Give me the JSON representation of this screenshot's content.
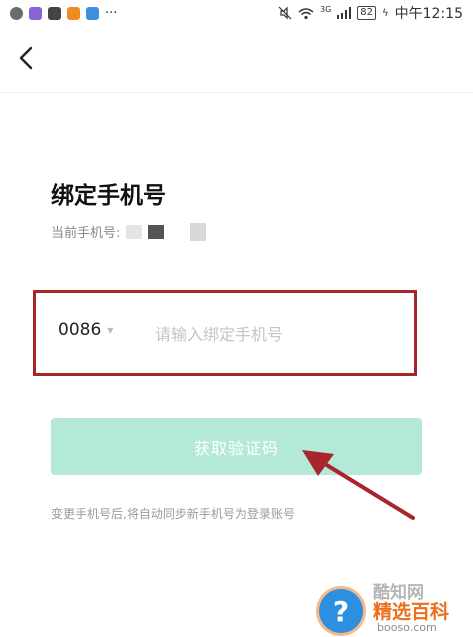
{
  "status_bar": {
    "battery": "82",
    "network": "3G",
    "time": "中午12:15",
    "app_icons": [
      {
        "name": "message-app-icon",
        "color": "#6b6b6b"
      },
      {
        "name": "browser-app-icon",
        "color": "#8a64d6"
      },
      {
        "name": "mail-app-icon",
        "color": "#444444"
      },
      {
        "name": "store-app-icon",
        "color": "#f08a24"
      },
      {
        "name": "shield-app-icon",
        "color": "#3e8de0"
      }
    ]
  },
  "nav": {
    "back_icon": "chevron-left-icon"
  },
  "page": {
    "title": "绑定手机号",
    "current_phone_label": "当前手机号:"
  },
  "form": {
    "country_code": "0086",
    "phone_placeholder": "请输入绑定手机号",
    "phone_value": "",
    "get_code_label": "获取验证码",
    "note": "变更手机号后,将自动同步新手机号为登录账号"
  },
  "watermark": {
    "top": "酷知网",
    "brand": "精选百科",
    "url": "booso.com",
    "icon": "question-mark-icon"
  },
  "colors": {
    "button_bg": "#b4e8d8",
    "highlight_border": "#a8262a",
    "annotation_arrow": "#a8262a",
    "brand_orange": "#ec6f1c"
  }
}
